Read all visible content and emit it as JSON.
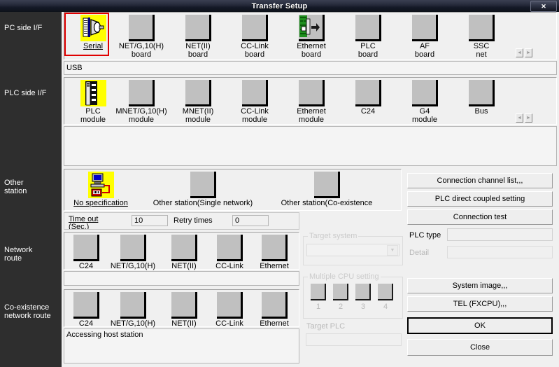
{
  "window": {
    "title": "Transfer Setup",
    "close_label": "✕"
  },
  "sidebar": {
    "items": [
      {
        "key": "pc_side",
        "label": "PC side I/F"
      },
      {
        "key": "plc_side",
        "label": "PLC side I/F"
      },
      {
        "key": "other_station",
        "label": "Other\nstation"
      },
      {
        "key": "network_route",
        "label": "Network\nroute"
      },
      {
        "key": "coexistence_route",
        "label": "Co-existence\nnetwork route"
      }
    ]
  },
  "pc_side": {
    "icons": [
      {
        "label": "Serial",
        "icon": "serial-icon",
        "selected": true,
        "underline": true
      },
      {
        "label": "NET/G,10(H)\nboard",
        "icon": "board-icon",
        "selected": false
      },
      {
        "label": "NET(II)\nboard",
        "icon": "board-icon",
        "selected": false
      },
      {
        "label": "CC-Link\nboard",
        "icon": "board-icon",
        "selected": false
      },
      {
        "label": "Ethernet\nboard",
        "icon": "ethernet-board-icon",
        "selected": false
      },
      {
        "label": "PLC\nboard",
        "icon": "board-icon",
        "selected": false
      },
      {
        "label": "AF\nboard",
        "icon": "board-icon",
        "selected": false
      },
      {
        "label": "SSC\nnet",
        "icon": "board-icon",
        "selected": false
      }
    ],
    "scroll_left": "◄",
    "scroll_right": "►",
    "detail_value": "USB"
  },
  "plc_side": {
    "icons": [
      {
        "label": "PLC\nmodule",
        "icon": "plc-module-icon",
        "selected": true
      },
      {
        "label": "MNET/G,10(H)\nmodule",
        "icon": "module-icon",
        "selected": false
      },
      {
        "label": "MNET(II)\nmodule",
        "icon": "module-icon",
        "selected": false
      },
      {
        "label": "CC-Link\nmodule",
        "icon": "module-icon",
        "selected": false
      },
      {
        "label": "Ethernet\nmodule",
        "icon": "module-icon",
        "selected": false
      },
      {
        "label": "C24",
        "icon": "module-icon",
        "selected": false
      },
      {
        "label": "G4\nmodule",
        "icon": "module-icon",
        "selected": false
      },
      {
        "label": "Bus",
        "icon": "module-icon",
        "selected": false
      }
    ],
    "scroll_left": "◄",
    "scroll_right": "►",
    "detail_value": ""
  },
  "other_station": {
    "icons": [
      {
        "label": "No specification",
        "icon": "no-specification-icon",
        "selected": true,
        "underline": true
      },
      {
        "label": "Other station(Single network)",
        "icon": "station-icon",
        "selected": false
      },
      {
        "label": "Other station(Co-existence",
        "icon": "station-icon",
        "selected": false
      }
    ],
    "timeout_label": "Time out\n(Sec.)",
    "timeout_value": "10",
    "retry_label": "Retry times",
    "retry_value": "0"
  },
  "network_route": {
    "icons": [
      {
        "label": "C24"
      },
      {
        "label": "NET/G,10(H)"
      },
      {
        "label": "NET(II)"
      },
      {
        "label": "CC-Link"
      },
      {
        "label": "Ethernet"
      }
    ],
    "detail_value": ""
  },
  "coexistence_route": {
    "icons": [
      {
        "label": "C24"
      },
      {
        "label": "NET/G,10(H)"
      },
      {
        "label": "NET(II)"
      },
      {
        "label": "CC-Link"
      },
      {
        "label": "Ethernet"
      }
    ],
    "detail_value": "Accessing host station"
  },
  "target_system": {
    "group_title": "Target system",
    "combo_value": "",
    "combo_arrow": "▼"
  },
  "multiple_cpu": {
    "group_title": "Multiple CPU setting",
    "slots": [
      "1",
      "2",
      "3",
      "4"
    ],
    "target_plc_label": "Target PLC",
    "target_plc_value": ""
  },
  "right_panel": {
    "connection_channel_list": "Connection  channel  list,,,",
    "plc_direct_coupled_setting": "PLC direct coupled setting",
    "connection_test": "Connection test",
    "plc_type_label": "PLC type",
    "plc_type_value": "",
    "detail_label": "Detail",
    "detail_value": "",
    "system_image": "System   image,,,",
    "tel_fxcpu": "TEL (FXCPU),,,",
    "ok": "OK",
    "close": "Close"
  },
  "colors": {
    "selected_border": "#e00000",
    "selected_fill": "#ffff00",
    "sidebar_bg": "#2e2e2e",
    "window_bg": "#f0f0f0",
    "titlebar_bg": "#1a1f2e"
  }
}
